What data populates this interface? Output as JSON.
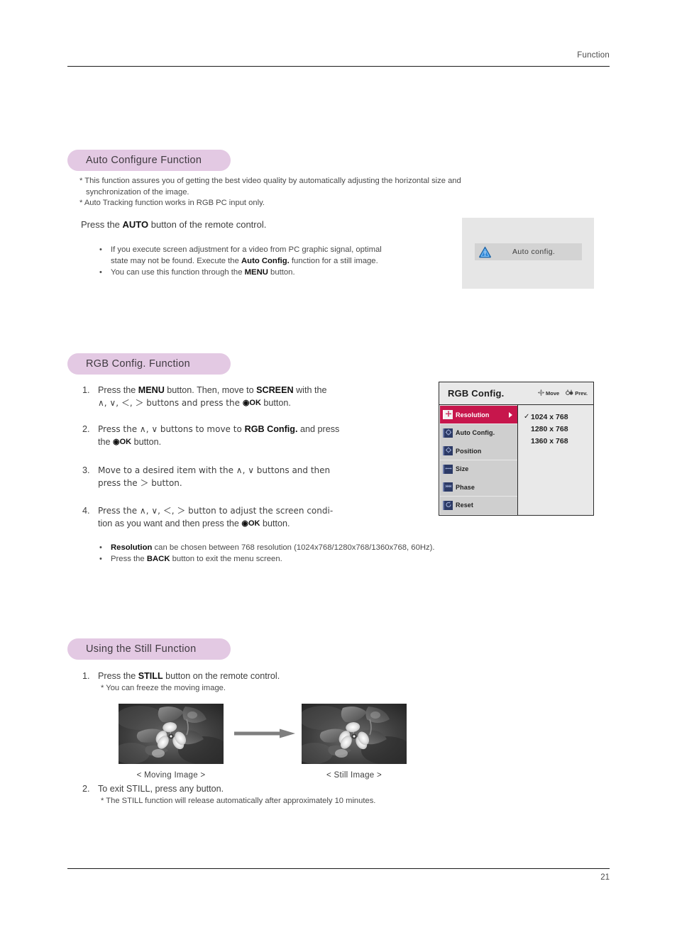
{
  "page": {
    "header_label": "Function",
    "page_number": "21"
  },
  "sections": {
    "auto_configure": {
      "heading": "Auto Configure Function",
      "notes": [
        "* This function assures you of getting the best video quality by automatically adjusting the horizontal size and",
        "synchronization of the image.",
        "* Auto Tracking function works in RGB PC input only."
      ],
      "lead_before": "Press the ",
      "lead_bold": "AUTO",
      "lead_after": " button of the remote control.",
      "bullets": [
        {
          "marker": "•",
          "line1_a": "If you execute screen adjustment for a video from PC graphic signal, optimal",
          "line2_a": "state may not be found. Execute the ",
          "line2_bold": "Auto Config.",
          "line2_b": " function for a still image."
        },
        {
          "marker": "•",
          "text_a": "You can use this function through the ",
          "text_bold": "MENU",
          "text_b": " button."
        }
      ],
      "osd": {
        "icon_name": "warning-triangle-icon",
        "label": "Auto config."
      }
    },
    "rgb_config": {
      "heading": "RGB Config. Function",
      "steps": [
        {
          "num": "1.",
          "l1_a": "Press the ",
          "l1_b1": "MENU",
          "l1_b": " button. Then, move to ",
          "l1_b2": "SCREEN",
          "l1_c": " with the",
          "l2_a": "∧, ∨, ＜, ＞ buttons and press the ",
          "l2_ok": "◉OK",
          "l2_b": " button."
        },
        {
          "num": "2.",
          "l1_a": "Press the ∧, ∨ buttons to move to ",
          "l1_b1": "RGB Config.",
          "l1_c": " and press",
          "l2_a": "the ",
          "l2_ok": "◉OK",
          "l2_b": " button."
        },
        {
          "num": "3.",
          "l1_a": "Move to a desired item with the ∧, ∨ buttons and then",
          "l2_a": "press the ＞  button."
        },
        {
          "num": "4.",
          "l1_a": "Press the ∧, ∨, ＜, ＞  button to adjust the screen condi-",
          "l2_a": "tion as you want and then press the ",
          "l2_ok": "◉OK",
          "l2_b": " button."
        }
      ],
      "bullets": [
        {
          "marker": "•",
          "bold": "Resolution",
          "text": " can be chosen between 768 resolution (1024x768/1280x768/1360x768, 60Hz)."
        },
        {
          "marker": "•",
          "pre": "Press the ",
          "bold": "BACK",
          "text": " button to exit the menu screen."
        }
      ],
      "osd": {
        "title": "RGB Config.",
        "hints": [
          {
            "icon_name": "move-arrows-icon",
            "label": "Move"
          },
          {
            "icon_name": "prev-back-icon",
            "label": "Prev."
          }
        ],
        "menu_items": [
          {
            "label": "Resolution",
            "icon_name": "resolution-icon",
            "selected": true
          },
          {
            "label": "Auto Config.",
            "icon_name": "auto-config-icon",
            "selected": false
          },
          {
            "label": "Position",
            "icon_name": "position-icon",
            "selected": false
          },
          {
            "label": "Size",
            "icon_name": "size-icon",
            "selected": false
          },
          {
            "label": "Phase",
            "icon_name": "phase-icon",
            "selected": false
          },
          {
            "label": "Reset",
            "icon_name": "reset-icon",
            "selected": false
          }
        ],
        "values": [
          {
            "check": "✓",
            "label": "1024 x 768"
          },
          {
            "check": "",
            "label": "1280 x 768"
          },
          {
            "check": "",
            "label": "1360 x 768"
          }
        ]
      }
    },
    "still_function": {
      "heading": "Using the Still Function",
      "step1_num": "1.",
      "step1_a": "Press the ",
      "step1_bold": "STILL",
      "step1_b": " button on the remote control.",
      "step1_note": "* You can freeze the moving image.",
      "image_left_caption": "< Moving Image >",
      "image_right_caption": "< Still Image >",
      "arrow_icon_name": "right-arrow-icon",
      "step2_num": "2.",
      "step2_text": "To exit STILL, press any button.",
      "step2_note": "* The STILL function will release automatically after approximately 10 minutes."
    }
  },
  "colors": {
    "pill_background": "#e3c9e3",
    "osd_selected": "#c7164c",
    "osd_panel": "#e9e9e9",
    "osd_item": "#cfcfcf",
    "warning_icon": "#2e86d8",
    "arrow_gray": "#808080"
  }
}
